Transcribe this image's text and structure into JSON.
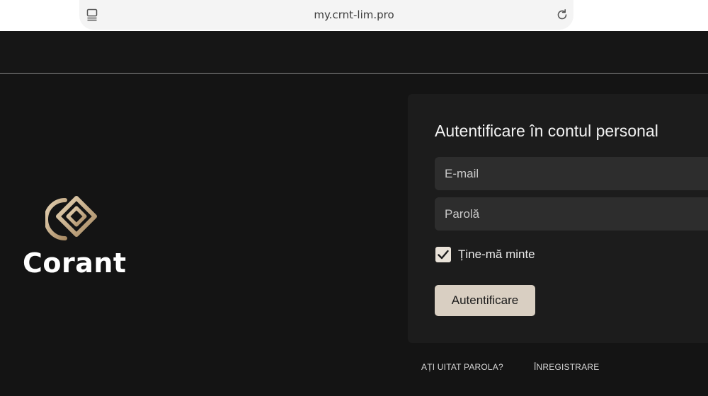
{
  "browser": {
    "url": "my.crnt-lim.pro",
    "icons": {
      "tabs": "tabs-icon",
      "reload": "reload-icon"
    }
  },
  "brand": {
    "name": "Corant",
    "accent_color": "#c8ad88",
    "logo_icon": "corant-logo-icon"
  },
  "login": {
    "title": "Autentificare în contul personal",
    "email_placeholder": "E-mail",
    "password_placeholder": "Parolă",
    "remember_label": "Ține-mă minte",
    "remember_checked": true,
    "submit_label": "Autentificare",
    "button_color": "#d9cfc2"
  },
  "footer": {
    "forgot_password": "AȚI UITAT PAROLA?",
    "register": "ÎNREGISTRARE"
  }
}
